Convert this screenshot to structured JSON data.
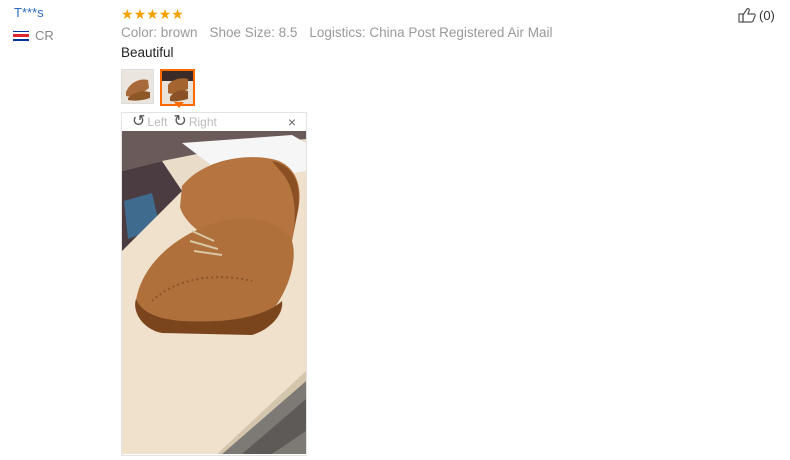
{
  "reviewer": {
    "name": "T***s",
    "country_code": "CR",
    "flag_colors": [
      "#0033a0",
      "#ffffff",
      "#e0262d",
      "#ffffff",
      "#0033a0"
    ]
  },
  "rating": {
    "stars": 5,
    "star_glyph": "★",
    "star_color": "#f4a000"
  },
  "meta": {
    "color": "Color: brown",
    "size": "Shoe Size: 8.5",
    "logistics": "Logistics: China Post Registered Air Mail"
  },
  "review_text": "Beautiful",
  "viewer": {
    "rotate_left_icon": "↺",
    "rotate_left_label": "Left",
    "rotate_right_icon": "↻",
    "rotate_right_label": "Right",
    "close_label": "×"
  },
  "like": {
    "count": "(0)"
  },
  "accent_color": "#ff6a00",
  "link_color": "#2b6bc2"
}
